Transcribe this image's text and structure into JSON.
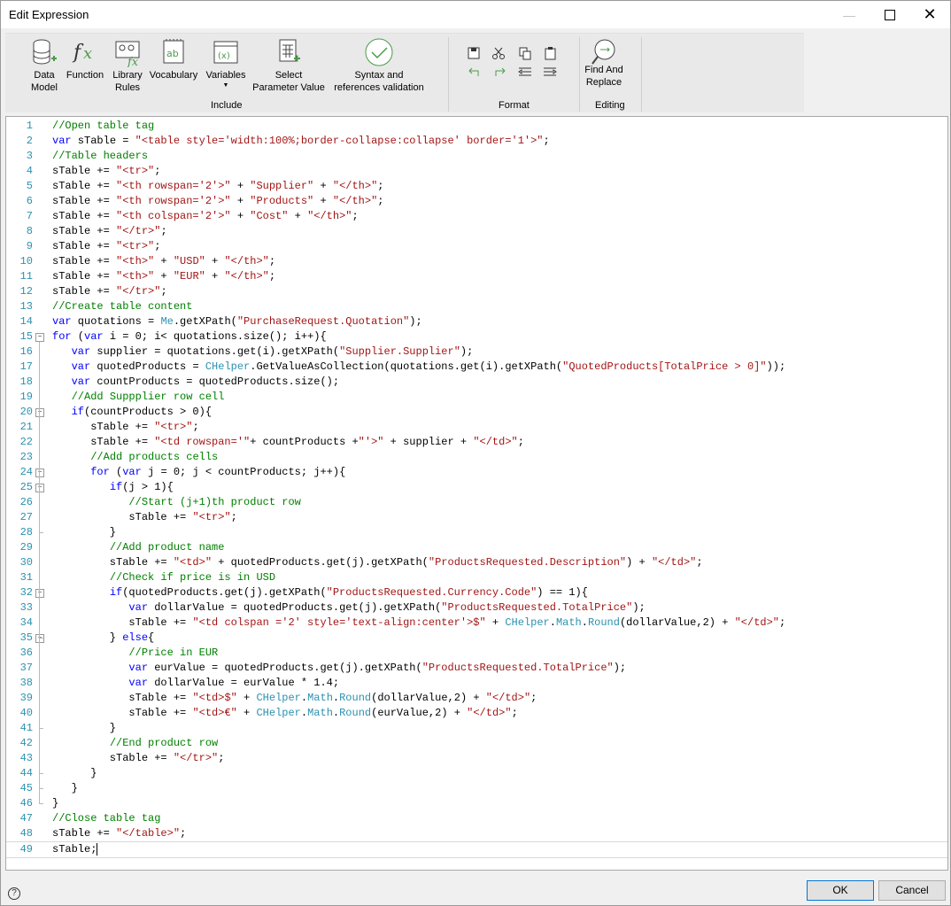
{
  "window": {
    "title": "Edit Expression"
  },
  "ribbon": {
    "tools": [
      {
        "id": "data-model",
        "label": "Data Model",
        "icon": "database-icon"
      },
      {
        "id": "function",
        "label": "Function",
        "icon": "fx-icon"
      },
      {
        "id": "library-rules",
        "label": "Library Rules",
        "icon": "library-rules-icon"
      },
      {
        "id": "vocabulary",
        "label": "Vocabulary",
        "icon": "vocabulary-icon"
      },
      {
        "id": "variables",
        "label": "Variables",
        "icon": "variables-icon"
      },
      {
        "id": "select-parameter-value",
        "label": "Select Parameter Value",
        "icon": "select-parameter-icon"
      },
      {
        "id": "syntax-validation",
        "label": "Syntax and references validation",
        "icon": "validation-check-icon"
      }
    ],
    "groups": {
      "include": "Include",
      "format": "Format",
      "editing": "Editing"
    },
    "find_replace": "Find And Replace"
  },
  "editor": {
    "cursor_line": 49,
    "lines": [
      "//Open table tag",
      "var sTable = \"<table style='width:100%;border-collapse:collapse' border='1'>\";",
      "//Table headers",
      "sTable += \"<tr>\";",
      "sTable += \"<th rowspan='2'>\" + \"Supplier\" + \"</th>\";",
      "sTable += \"<th rowspan='2'>\" + \"Products\" + \"</th>\";",
      "sTable += \"<th colspan='2'>\" + \"Cost\" + \"</th>\";",
      "sTable += \"</tr>\";",
      "sTable += \"<tr>\";",
      "sTable += \"<th>\" + \"USD\" + \"</th>\";",
      "sTable += \"<th>\" + \"EUR\" + \"</th>\";",
      "sTable += \"</tr>\";",
      "//Create table content",
      "var quotations = Me.getXPath(\"PurchaseRequest.Quotation\");",
      "for (var i = 0; i< quotations.size(); i++){",
      "   var supplier = quotations.get(i).getXPath(\"Supplier.Supplier\");",
      "   var quotedProducts = CHelper.GetValueAsCollection(quotations.get(i).getXPath(\"QuotedProducts[TotalPrice > 0]\"));",
      "   var countProducts = quotedProducts.size();",
      "   //Add Suppplier row cell",
      "   if(countProducts > 0){",
      "      sTable += \"<tr>\";",
      "      sTable += \"<td rowspan='\"+ countProducts +\"'>\" + supplier + \"</td>\";",
      "      //Add products cells",
      "      for (var j = 0; j < countProducts; j++){",
      "         if(j > 1){",
      "            //Start (j+1)th product row",
      "            sTable += \"<tr>\";",
      "         }",
      "         //Add product name",
      "         sTable += \"<td>\" + quotedProducts.get(j).getXPath(\"ProductsRequested.Description\") + \"</td>\";",
      "         //Check if price is in USD",
      "         if(quotedProducts.get(j).getXPath(\"ProductsRequested.Currency.Code\") == 1){",
      "            var dollarValue = quotedProducts.get(j).getXPath(\"ProductsRequested.TotalPrice\");",
      "            sTable += \"<td colspan ='2' style='text-align:center'>$\" + CHelper.Math.Round(dollarValue,2) + \"</td>\";",
      "         } else{",
      "            //Price in EUR",
      "            var eurValue = quotedProducts.get(j).getXPath(\"ProductsRequested.TotalPrice\");",
      "            var dollarValue = eurValue * 1.4;",
      "            sTable += \"<td>$\" + CHelper.Math.Round(dollarValue,2) + \"</td>\";",
      "            sTable += \"<td>€\" + CHelper.Math.Round(eurValue,2) + \"</td>\";",
      "         }",
      "         //End product row",
      "         sTable += \"</tr>\";",
      "      }",
      "   }",
      "}",
      "//Close table tag",
      "sTable += \"</table>\";",
      "sTable;"
    ]
  },
  "footer": {
    "help": "?",
    "ok": "OK",
    "cancel": "Cancel"
  }
}
